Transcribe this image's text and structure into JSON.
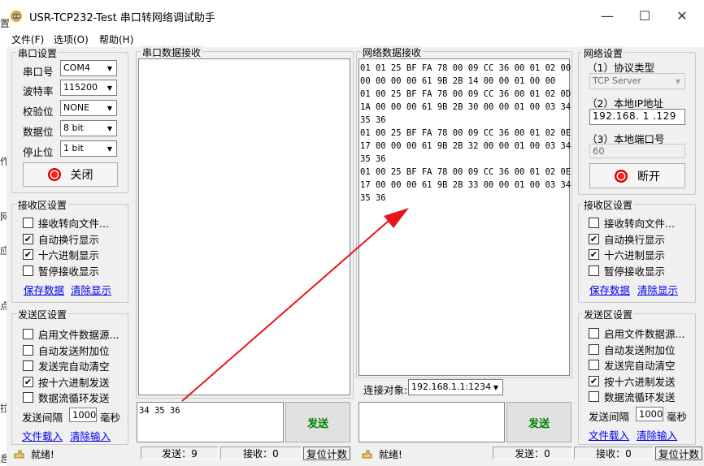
{
  "window": {
    "title": "USR-TCP232-Test 串口转网络调试助手",
    "controls": {
      "minimize": "—",
      "maximize": "☐",
      "close": "✕"
    }
  },
  "menu": [
    "文件(F)",
    "选项(O)",
    "帮助(H)"
  ],
  "left_strip_fragments": [
    "置",
    "作",
    "网",
    "应",
    "点",
    "拉",
    "息"
  ],
  "serial_settings": {
    "title": "串口设置",
    "port_label": "串口号",
    "port_value": "COM4",
    "baud_label": "波特率",
    "baud_value": "115200",
    "parity_label": "校验位",
    "parity_value": "NONE",
    "data_bits_label": "数据位",
    "data_bits_value": "8 bit",
    "stop_bits_label": "停止位",
    "stop_bits_value": "1 bit",
    "close_button": "关闭"
  },
  "serial_receive_settings": {
    "title": "接收区设置",
    "options": [
      {
        "label": "接收转向文件...",
        "checked": false
      },
      {
        "label": "自动换行显示",
        "checked": true
      },
      {
        "label": "十六进制显示",
        "checked": true
      },
      {
        "label": "暂停接收显示",
        "checked": false
      }
    ],
    "save_link": "保存数据",
    "clear_link": "清除显示"
  },
  "serial_send_settings": {
    "title": "发送区设置",
    "options": [
      {
        "label": "启用文件数据源...",
        "checked": false
      },
      {
        "label": "自动发送附加位",
        "checked": false
      },
      {
        "label": "发送完自动清空",
        "checked": false
      },
      {
        "label": "按十六进制发送",
        "checked": true
      },
      {
        "label": "数据流循环发送",
        "checked": false
      }
    ],
    "interval_label": "发送间隔",
    "interval_value": "1000",
    "interval_unit": "毫秒",
    "load_file_link": "文件载入",
    "clear_input_link": "清除输入"
  },
  "serial_receive_panel": {
    "title": "串口数据接收",
    "content": ""
  },
  "serial_send_panel": {
    "content": "34 35 36",
    "send_button": "发送"
  },
  "network_receive_panel": {
    "title": "网络数据接收",
    "lines": [
      "01 01 25 BF FA 78 00 09 CC 36 00 01 02 00",
      "00 00 00 00 61 9B 2B 14 00 00 01 00 00",
      "01 00 25 BF FA 78 00 09 CC 36 00 01 02 0D",
      "1A 00 00 00 61 9B 2B 30 00 00 01 00 03 34",
      "35 36",
      "01 00 25 BF FA 78 00 09 CC 36 00 01 02 0E",
      "17 00 00 00 61 9B 2B 32 00 00 01 00 03 34",
      "35 36",
      "01 00 25 BF FA 78 00 09 CC 36 00 01 02 0E",
      "17 00 00 00 61 9B 2B 33 00 00 01 00 03 34",
      "35 36"
    ]
  },
  "network_connection": {
    "label": "连接对象:",
    "value": "192.168.1.1:1234"
  },
  "network_send_panel": {
    "content": "",
    "send_button": "发送"
  },
  "network_settings": {
    "title": "网络设置",
    "protocol_label": "（1）协议类型",
    "protocol_value": "TCP Server",
    "ip_label": "（2）本地IP地址",
    "ip_value": "192.168. 1 .129",
    "port_label": "（3）本地端口号",
    "port_value": "60",
    "disconnect_button": "断开"
  },
  "network_receive_settings": {
    "title": "接收区设置",
    "options": [
      {
        "label": "接收转向文件...",
        "checked": false
      },
      {
        "label": "自动换行显示",
        "checked": true
      },
      {
        "label": "十六进制显示",
        "checked": true
      },
      {
        "label": "暂停接收显示",
        "checked": false
      }
    ],
    "save_link": "保存数据",
    "clear_link": "清除显示"
  },
  "network_send_settings": {
    "title": "发送区设置",
    "options": [
      {
        "label": "启用文件数据源...",
        "checked": false
      },
      {
        "label": "自动发送附加位",
        "checked": false
      },
      {
        "label": "发送完自动清空",
        "checked": false
      },
      {
        "label": "按十六进制发送",
        "checked": true
      },
      {
        "label": "数据流循环发送",
        "checked": false
      }
    ],
    "interval_label": "发送间隔",
    "interval_value": "1000",
    "interval_unit": "毫秒",
    "load_file_link": "文件载入",
    "clear_input_link": "清除输入"
  },
  "serial_status": {
    "ready": "就绪!",
    "sent": "发送：9",
    "received": "接收：0",
    "reset": "复位计数"
  },
  "network_status": {
    "ready": "就绪!",
    "sent": "发送：0",
    "received": "接收：0",
    "reset": "复位计数"
  },
  "colors": {
    "arrow": "#e8141c",
    "led": "#e00000",
    "send_text": "#008000",
    "link": "#0000ee"
  }
}
